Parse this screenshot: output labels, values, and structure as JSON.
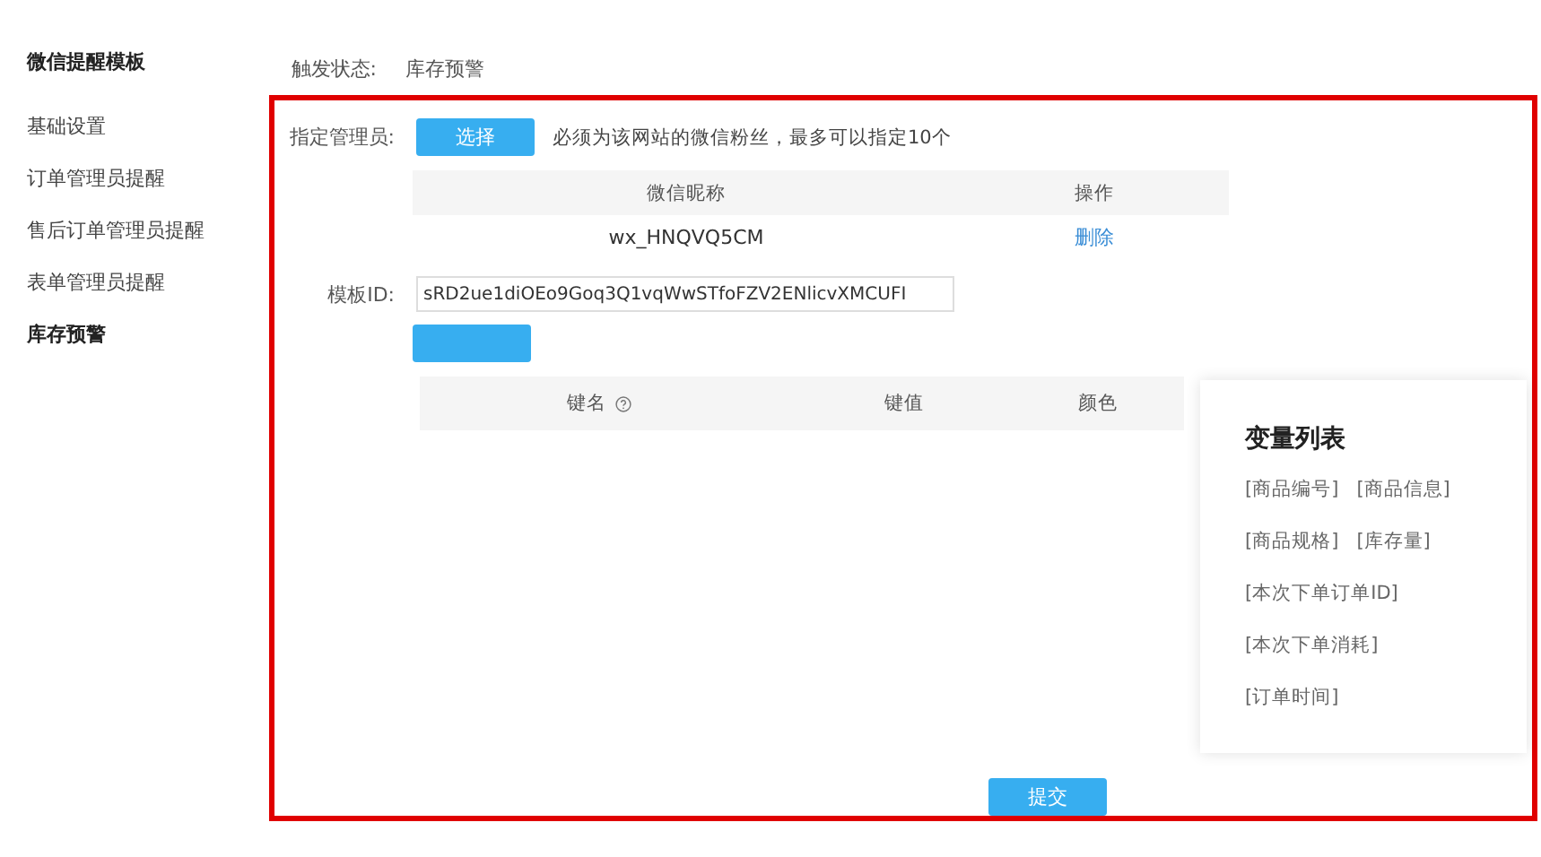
{
  "sidebar": {
    "title": "微信提醒模板",
    "items": [
      {
        "label": "基础设置",
        "selected": false
      },
      {
        "label": "订单管理员提醒",
        "selected": false
      },
      {
        "label": "售后订单管理员提醒",
        "selected": false
      },
      {
        "label": "表单管理员提醒",
        "selected": false
      },
      {
        "label": "库存预警",
        "selected": true
      }
    ]
  },
  "trigger": {
    "label": "触发状态:",
    "value": "库存预警"
  },
  "admin": {
    "label": "指定管理员:",
    "button": "选择",
    "hint": "必须为该网站的微信粉丝，最多可以指定10个",
    "table": {
      "columns": [
        "微信昵称",
        "操作"
      ],
      "rows": [
        {
          "nickname": "wx_HNQVQ5CM",
          "action": "删除"
        }
      ]
    }
  },
  "template_id": {
    "label": "模板ID:",
    "value": "sRD2ue1diOEo9Goq3Q1vqWwSTfoFZV2ENlicvXMCUFI"
  },
  "key_table": {
    "columns": [
      {
        "label": "键名",
        "help": true
      },
      {
        "label": "键值",
        "help": false
      },
      {
        "label": "颜色",
        "help": false
      }
    ]
  },
  "variables": {
    "title": "变量列表",
    "rows": [
      [
        "[商品编号]",
        "[商品信息]"
      ],
      [
        "[商品规格]",
        "[库存量]"
      ],
      [
        "[本次下单订单ID]"
      ],
      [
        "[本次下单消耗]"
      ],
      [
        "[订单时间]"
      ]
    ]
  },
  "submit": "提交"
}
